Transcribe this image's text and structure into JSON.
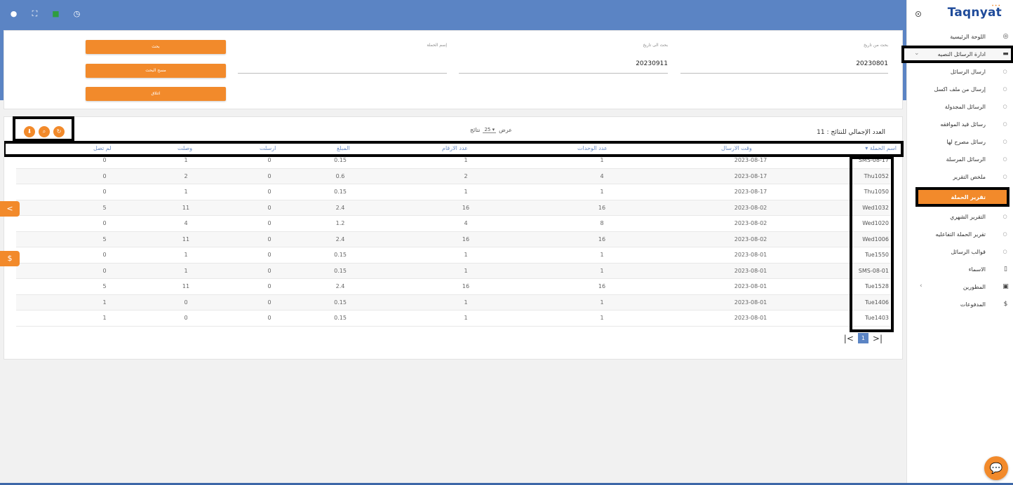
{
  "brand": {
    "name": "Taqnyat",
    "dots": "•••"
  },
  "header_icons": [
    "user-circle-icon",
    "fullscreen-icon",
    "flag-icon",
    "clock-icon"
  ],
  "sidebar": {
    "items": [
      {
        "label": "اللوحة الرئيسية",
        "icon": "dashboard-icon",
        "glyph": "◎",
        "type": "main"
      },
      {
        "label": "ادارة الرسائل النصيه",
        "icon": "messages-icon",
        "glyph": "▬",
        "type": "main",
        "expanded": true
      },
      {
        "label": "ارسال الرسائل",
        "type": "sub"
      },
      {
        "label": "إرسال من ملف اكسل",
        "type": "sub"
      },
      {
        "label": "الرسائل المجدولة",
        "type": "sub"
      },
      {
        "label": "رسائل قيد الموافقه",
        "type": "sub"
      },
      {
        "label": "رسائل مصرح لها",
        "type": "sub"
      },
      {
        "label": "الرسائل المرسلة",
        "type": "sub"
      },
      {
        "label": "ملخص التقرير",
        "type": "sub"
      },
      {
        "label": "تقرير الحملة",
        "type": "sub",
        "active": true
      },
      {
        "label": "التقرير الشهري",
        "type": "sub"
      },
      {
        "label": "تقرير الحملة التفاعليه",
        "type": "sub"
      },
      {
        "label": "قوالب الرسائل",
        "type": "sub"
      },
      {
        "label": "الاسماء",
        "icon": "book-icon",
        "glyph": "▯",
        "type": "main"
      },
      {
        "label": "المطورين",
        "icon": "code-icon",
        "glyph": "▣",
        "type": "main",
        "has_chevron": true
      },
      {
        "label": "المدفوعات",
        "icon": "dollar-icon",
        "glyph": "$",
        "type": "main"
      }
    ]
  },
  "search": {
    "from_date": {
      "label": "بحث من تاريخ",
      "value": "20230801"
    },
    "to_date": {
      "label": "بحث الى تاريخ",
      "value": "20230911"
    },
    "campaign_name": {
      "label": "إسم الحملة",
      "value": ""
    },
    "buttons": {
      "search": "بحث",
      "clear": "مسح البحث",
      "close": "اغلاق"
    }
  },
  "results": {
    "total_label": "العدد الإجمالي للنتائج : 11",
    "per_page_prefix": "عرض",
    "per_page_value": "25",
    "per_page_suffix": "نتائج",
    "columns": [
      "اسم الحملة",
      "وقت الارسال",
      "عدد الوحدات",
      "عدد الارقام",
      "المبلغ",
      "ارسلت",
      "وصلت",
      "لم تصل"
    ],
    "sort_indicator": "▾",
    "rows": [
      {
        "name": "SMS-08-17",
        "time": "2023-08-17",
        "units": "1",
        "numbers": "1",
        "amount": "0.15",
        "sent": "0",
        "delivered": "1",
        "failed": "0"
      },
      {
        "name": "Thu1052",
        "time": "2023-08-17",
        "units": "4",
        "numbers": "2",
        "amount": "0.6",
        "sent": "0",
        "delivered": "2",
        "failed": "0"
      },
      {
        "name": "Thu1050",
        "time": "2023-08-17",
        "units": "1",
        "numbers": "1",
        "amount": "0.15",
        "sent": "0",
        "delivered": "1",
        "failed": "0"
      },
      {
        "name": "Wed1032",
        "time": "2023-08-02",
        "units": "16",
        "numbers": "16",
        "amount": "2.4",
        "sent": "0",
        "delivered": "11",
        "failed": "5"
      },
      {
        "name": "Wed1020",
        "time": "2023-08-02",
        "units": "8",
        "numbers": "4",
        "amount": "1.2",
        "sent": "0",
        "delivered": "4",
        "failed": "0"
      },
      {
        "name": "Wed1006",
        "time": "2023-08-02",
        "units": "16",
        "numbers": "16",
        "amount": "2.4",
        "sent": "0",
        "delivered": "11",
        "failed": "5"
      },
      {
        "name": "Tue1550",
        "time": "2023-08-01",
        "units": "1",
        "numbers": "1",
        "amount": "0.15",
        "sent": "0",
        "delivered": "1",
        "failed": "0"
      },
      {
        "name": "SMS-08-01",
        "time": "2023-08-01",
        "units": "1",
        "numbers": "1",
        "amount": "0.15",
        "sent": "0",
        "delivered": "1",
        "failed": "0"
      },
      {
        "name": "Tue1528",
        "time": "2023-08-01",
        "units": "16",
        "numbers": "16",
        "amount": "2.4",
        "sent": "0",
        "delivered": "11",
        "failed": "5"
      },
      {
        "name": "Tue1406",
        "time": "2023-08-01",
        "units": "1",
        "numbers": "1",
        "amount": "0.15",
        "sent": "0",
        "delivered": "0",
        "failed": "1"
      },
      {
        "name": "Tue1403",
        "time": "2023-08-01",
        "units": "1",
        "numbers": "1",
        "amount": "0.15",
        "sent": "0",
        "delivered": "0",
        "failed": "1"
      }
    ],
    "pagination": {
      "current": "1",
      "first": "|<",
      "last": ">|"
    }
  },
  "floating": {
    "share": "<",
    "pay": "$"
  }
}
